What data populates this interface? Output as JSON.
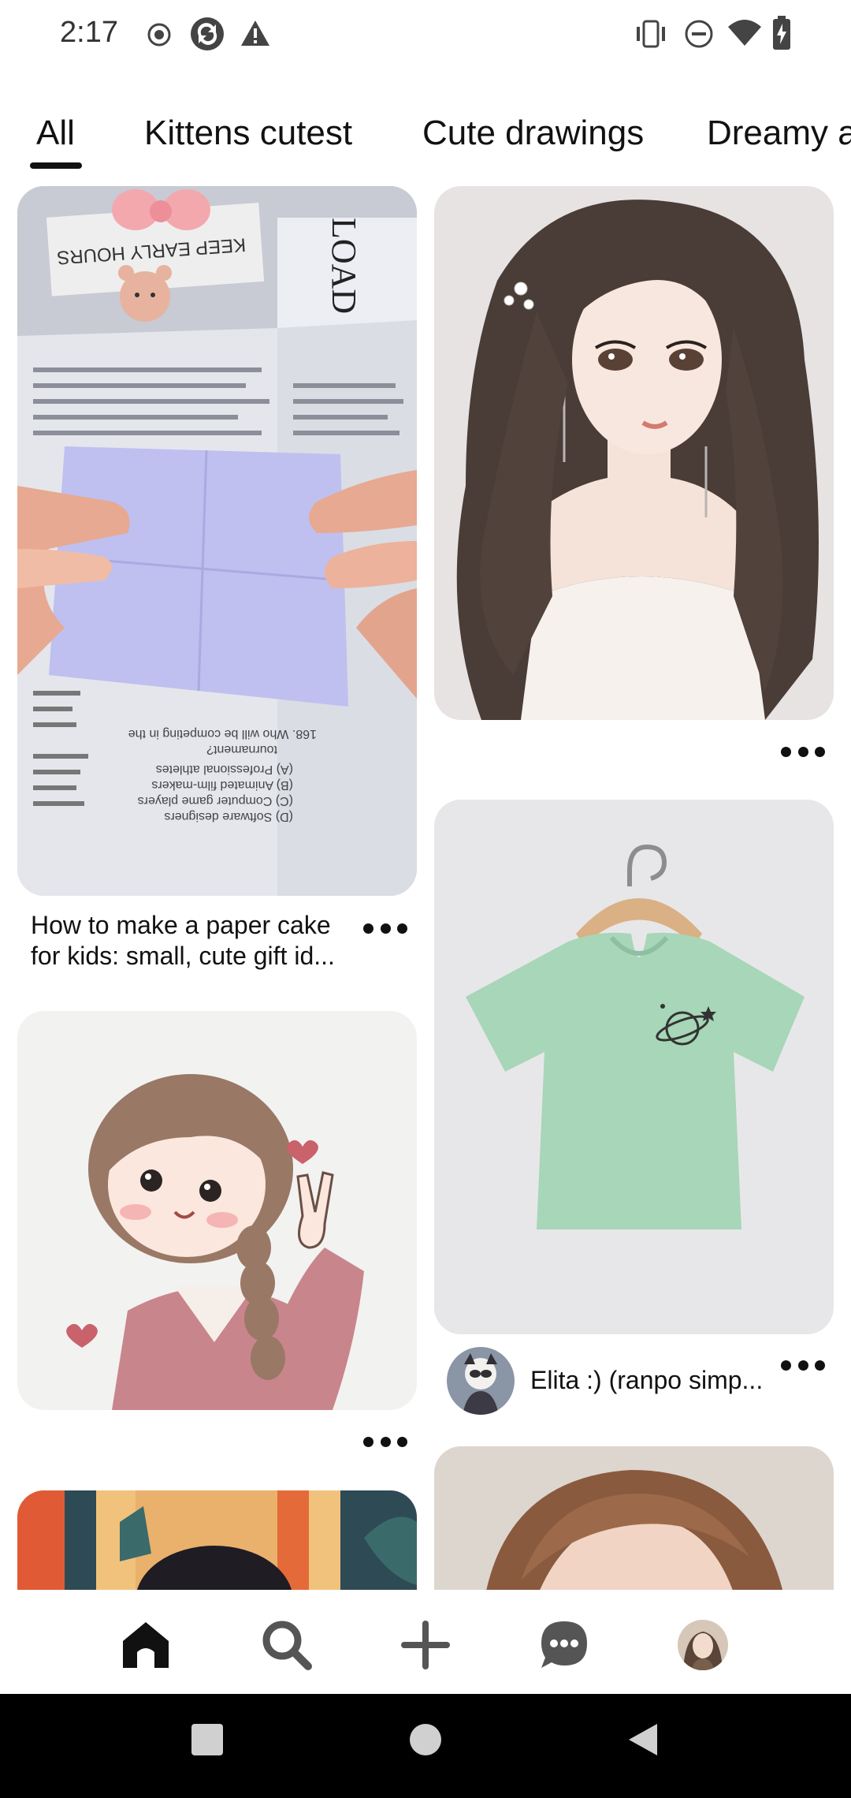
{
  "status_bar": {
    "time": "2:17"
  },
  "tabs": [
    {
      "label": "All",
      "selected": true
    },
    {
      "label": "Kittens cutest",
      "selected": false
    },
    {
      "label": "Cute drawings",
      "selected": false
    },
    {
      "label": "Dreamy a",
      "selected": false
    }
  ],
  "pins": {
    "paper_cake": {
      "title_line1": "How to make a paper cake",
      "title_line2": "for kids: small, cute gift id..."
    },
    "tshirt": {
      "creator_name": "Elita :) (ranpo simp..."
    },
    "paper_text": {
      "sign1": "KEEP EARLY HOURS",
      "sign2": "LOAD",
      "q1": "168. Who will be competing in the",
      "q2": "tournament?",
      "a1": "(A) Professional athletes",
      "a2": "(B) Animated film-makers",
      "a3": "(C) Computer game players",
      "a4": "(D) Software designers"
    }
  },
  "colors": {
    "accent": "#111111",
    "tshirt_green": "#a7d6b8",
    "system_nav_bg": "#000000"
  },
  "bottom_nav": {
    "items": [
      "home-icon",
      "search-icon",
      "create-icon",
      "messages-icon",
      "profile-icon"
    ]
  }
}
